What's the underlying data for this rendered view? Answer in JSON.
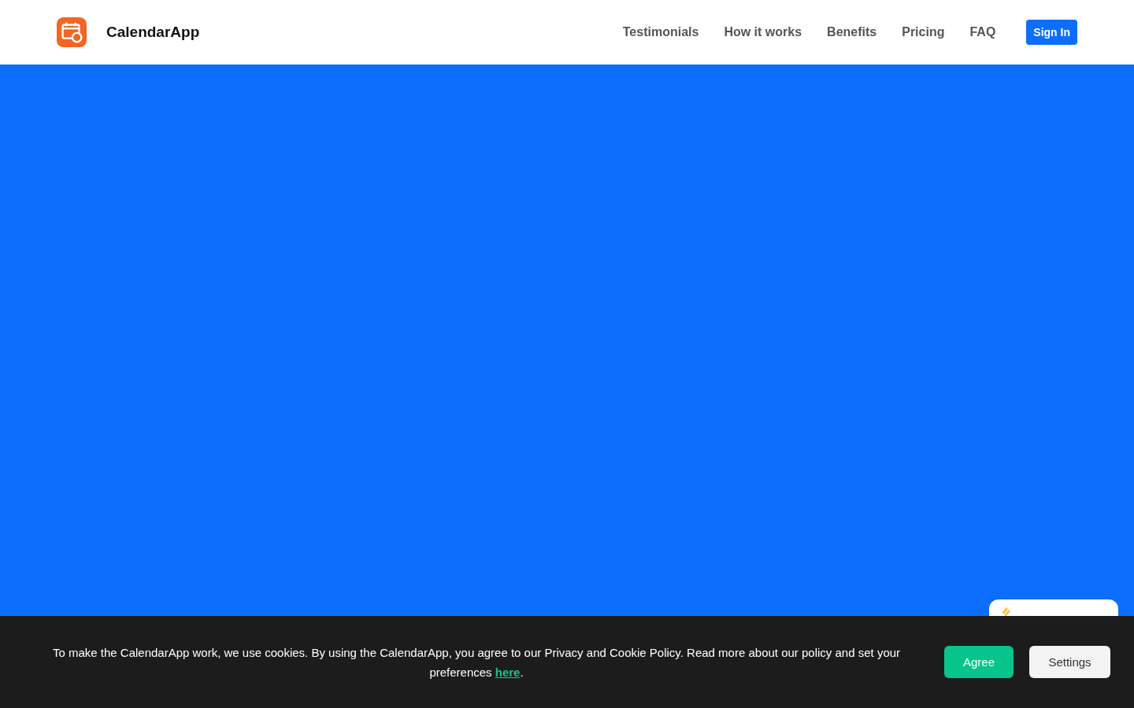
{
  "header": {
    "brand": "CalendarApp",
    "nav": [
      {
        "label": "Testimonials"
      },
      {
        "label": "How it works"
      },
      {
        "label": "Benefits"
      },
      {
        "label": "Pricing"
      },
      {
        "label": "FAQ"
      }
    ],
    "sign_in": "Sign In"
  },
  "cookie_banner": {
    "text": "To make the CalendarApp work, we use cookies. By using the CalendarApp, you agree to our Privacy and Cookie Policy. Read more about our policy and set your preferences ",
    "link": "here",
    "after": ".",
    "buttons": [
      {
        "label": "Agree",
        "kind": "primary"
      },
      {
        "label": "Settings",
        "kind": "secondary"
      }
    ]
  }
}
